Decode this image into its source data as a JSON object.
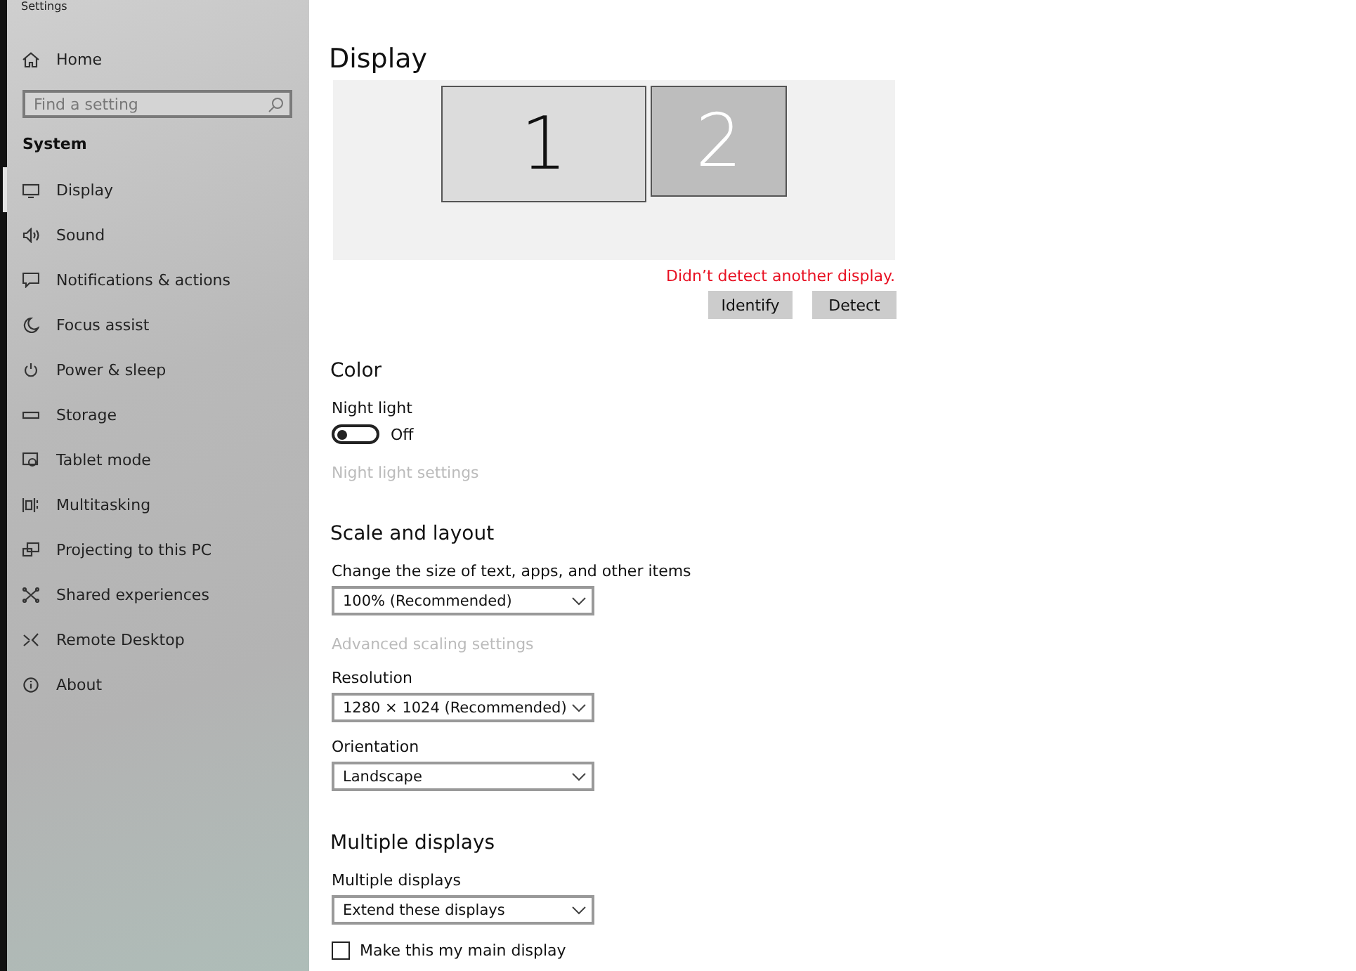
{
  "window": {
    "title": "Settings"
  },
  "sidebar": {
    "home": "Home",
    "search": {
      "placeholder": "Find a setting"
    },
    "section": "System",
    "items": [
      {
        "label": "Display",
        "selected": true
      },
      {
        "label": "Sound",
        "selected": false
      },
      {
        "label": "Notifications & actions",
        "selected": false
      },
      {
        "label": "Focus assist",
        "selected": false
      },
      {
        "label": "Power & sleep",
        "selected": false
      },
      {
        "label": "Storage",
        "selected": false
      },
      {
        "label": "Tablet mode",
        "selected": false
      },
      {
        "label": "Multitasking",
        "selected": false
      },
      {
        "label": "Projecting to this PC",
        "selected": false
      },
      {
        "label": "Shared experiences",
        "selected": false
      },
      {
        "label": "Remote Desktop",
        "selected": false
      },
      {
        "label": "About",
        "selected": false
      }
    ]
  },
  "page": {
    "title": "Display",
    "monitors": [
      {
        "number": "1",
        "selected": true
      },
      {
        "number": "2",
        "selected": false
      }
    ],
    "error": "Didn’t detect another display.",
    "buttons": [
      "Identify",
      "Detect"
    ],
    "sections": [
      {
        "heading": "Color",
        "controls": [
          {
            "kind": "toggle",
            "label": "Night light",
            "on": false,
            "state": "Off"
          },
          {
            "kind": "link",
            "text": "Night light settings",
            "disabled": true
          }
        ]
      },
      {
        "heading": "Scale and layout",
        "controls": [
          {
            "kind": "dropdown",
            "label": "Change the size of text, apps, and other items",
            "value": "100% (Recommended)"
          },
          {
            "kind": "link",
            "text": "Advanced scaling settings",
            "disabled": true
          },
          {
            "kind": "dropdown",
            "label": "Resolution",
            "value": "1280 × 1024 (Recommended)"
          },
          {
            "kind": "dropdown",
            "label": "Orientation",
            "value": "Landscape"
          }
        ]
      },
      {
        "heading": "Multiple displays",
        "controls": [
          {
            "kind": "dropdown",
            "label": "Multiple displays",
            "value": "Extend these displays"
          },
          {
            "kind": "checkbox",
            "label": "Make this my main display",
            "checked": false
          }
        ]
      }
    ]
  }
}
